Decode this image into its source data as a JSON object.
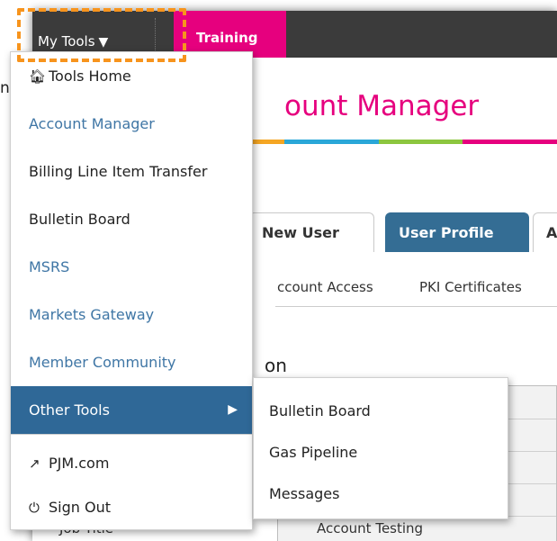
{
  "topbar": {
    "my_tools_label": "My Tools",
    "training_label": "Training"
  },
  "page": {
    "title": "ount Manager",
    "left_fragment": "ny",
    "section_heading": "on",
    "job_title_fragment": "Job Title",
    "account_value": "Account Testing"
  },
  "tabs": {
    "new_user": "New User",
    "user_profile": "User Profile",
    "more": "A"
  },
  "subnav": {
    "account_access": "ccount Access",
    "pki_certificates": "PKI Certificates"
  },
  "menu": {
    "tools_home": "Tools Home",
    "account_manager": "Account Manager",
    "billing": "Billing Line Item Transfer",
    "bulletin_board": "Bulletin Board",
    "msrs": "MSRS",
    "markets_gateway": "Markets Gateway",
    "member_community": "Member Community",
    "other_tools": "Other Tools",
    "pjm": "PJM.com",
    "sign_out": "Sign Out"
  },
  "submenu": {
    "bulletin_board": "Bulletin Board",
    "gas_pipeline": "Gas Pipeline",
    "messages": "Messages"
  },
  "colors": {
    "accent_pink": "#e6007e",
    "active_blue": "#2f6897",
    "topbar": "#3b3b3b",
    "highlight_orange": "#f7941d",
    "link_blue": "#3f76a5"
  },
  "icons": {
    "tools_home": "home-icon",
    "pjm": "external-link-icon",
    "sign_out": "power-icon",
    "my_tools": "caret-down-icon",
    "other_tools": "caret-right-icon"
  }
}
